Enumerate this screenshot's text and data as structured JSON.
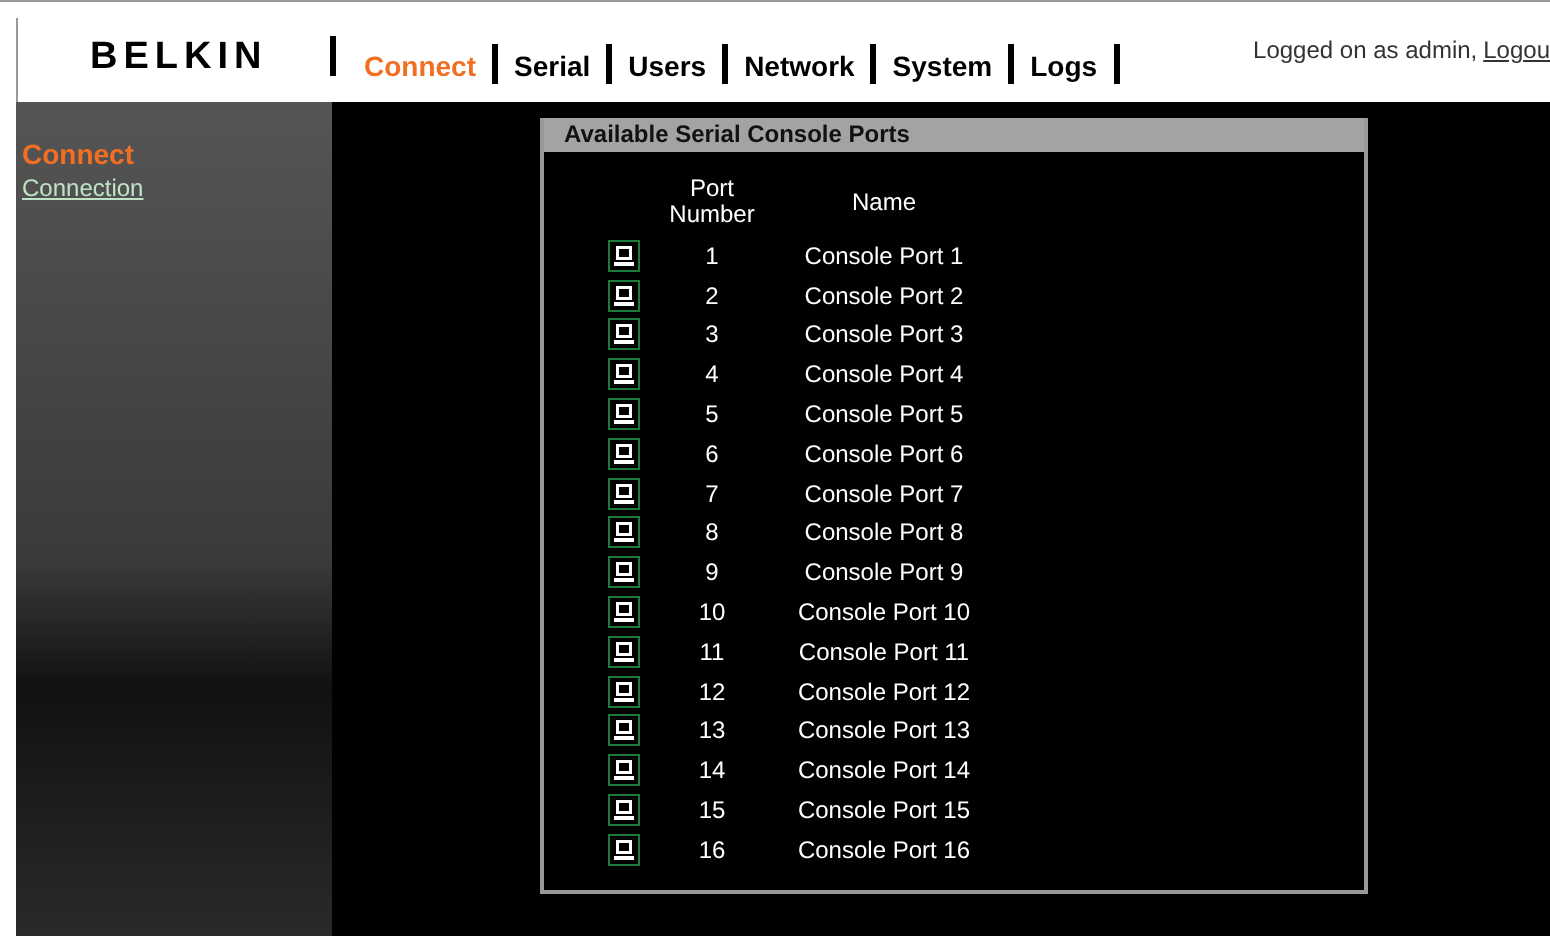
{
  "header": {
    "logo": "BELKIN",
    "tabs": [
      {
        "label": "Connect",
        "selected": true
      },
      {
        "label": "Serial",
        "selected": false
      },
      {
        "label": "Users",
        "selected": false
      },
      {
        "label": "Network",
        "selected": false
      },
      {
        "label": "System",
        "selected": false
      },
      {
        "label": "Logs",
        "selected": false
      }
    ],
    "login_text": "Logged on as admin,",
    "logout_link": "Logou"
  },
  "sidebar": {
    "heading": "Connect",
    "items": [
      {
        "label": "Connection"
      }
    ]
  },
  "panel": {
    "title": "Available Serial Console Ports",
    "columns": [
      "Port Number",
      "Name"
    ],
    "rows": [
      {
        "port": "1",
        "name": "Console Port 1"
      },
      {
        "port": "2",
        "name": "Console Port 2"
      },
      {
        "port": "3",
        "name": "Console Port 3"
      },
      {
        "port": "4",
        "name": "Console Port 4"
      },
      {
        "port": "5",
        "name": "Console Port 5"
      },
      {
        "port": "6",
        "name": "Console Port 6"
      },
      {
        "port": "7",
        "name": "Console Port 7"
      },
      {
        "port": "8",
        "name": "Console Port 8"
      },
      {
        "port": "9",
        "name": "Console Port 9"
      },
      {
        "port": "10",
        "name": "Console Port 10"
      },
      {
        "port": "11",
        "name": "Console Port 11"
      },
      {
        "port": "12",
        "name": "Console Port 12"
      },
      {
        "port": "13",
        "name": "Console Port 13"
      },
      {
        "port": "14",
        "name": "Console Port 14"
      },
      {
        "port": "15",
        "name": "Console Port 15"
      },
      {
        "port": "16",
        "name": "Console Port 16"
      }
    ]
  }
}
